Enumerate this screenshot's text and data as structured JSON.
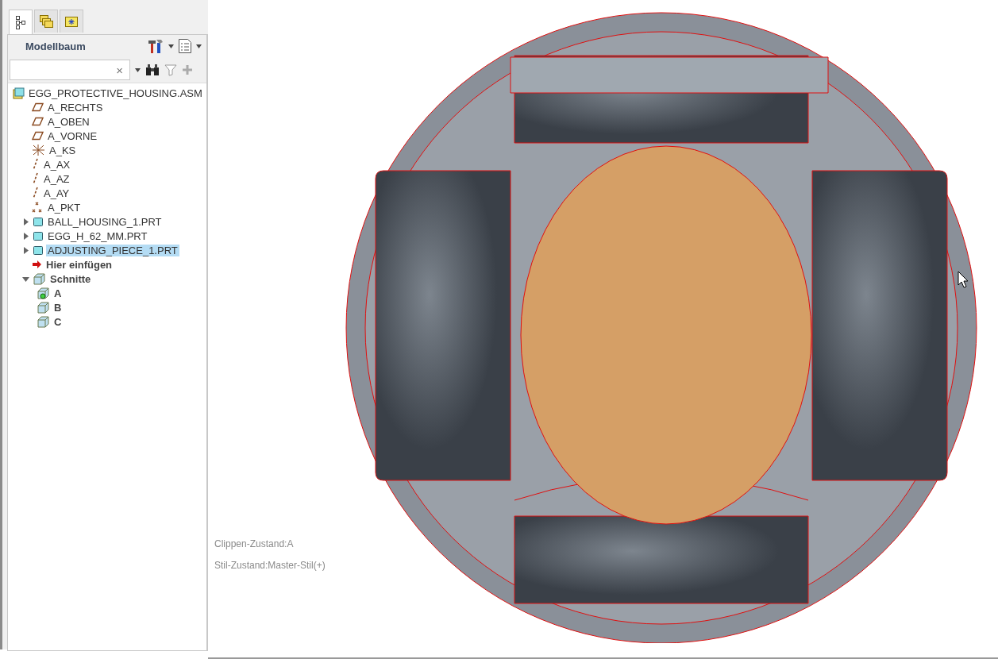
{
  "panel": {
    "tabs": [
      {
        "kind": "tree",
        "selected": true
      },
      {
        "kind": "layers",
        "selected": false
      },
      {
        "kind": "favorites",
        "selected": false
      }
    ],
    "title": "Modellbaum",
    "search": {
      "clear": "×"
    },
    "tree": [
      {
        "label": "EGG_PROTECTIVE_HOUSING.ASM",
        "kind": "assembly",
        "selected": false,
        "children": [
          {
            "label": "A_RECHTS",
            "kind": "plane",
            "selected": false
          },
          {
            "label": "A_OBEN",
            "kind": "plane",
            "selected": false
          },
          {
            "label": "A_VORNE",
            "kind": "plane",
            "selected": false
          },
          {
            "label": "A_KS",
            "kind": "csys",
            "selected": false
          },
          {
            "label": "A_AX",
            "kind": "axis",
            "selected": false
          },
          {
            "label": "A_AZ",
            "kind": "axis",
            "selected": false
          },
          {
            "label": "A_AY",
            "kind": "axis",
            "selected": false
          },
          {
            "label": "A_PKT",
            "kind": "point",
            "selected": false
          },
          {
            "label": "BALL_HOUSING_1.PRT",
            "kind": "part",
            "selected": false,
            "expanded": false
          },
          {
            "label": "EGG_H_62_MM.PRT",
            "kind": "part",
            "selected": false,
            "expanded": false
          },
          {
            "label": "ADJUSTING_PIECE_1.PRT",
            "kind": "part",
            "selected": true,
            "expanded": false
          },
          {
            "label": "Hier einfügen",
            "kind": "insert",
            "selected": false
          },
          {
            "label": "Schnitte",
            "kind": "sections",
            "selected": false,
            "expanded": true,
            "children": [
              {
                "label": "A",
                "kind": "section",
                "selected": false,
                "active": true
              },
              {
                "label": "B",
                "kind": "section",
                "selected": false,
                "active": false
              },
              {
                "label": "C",
                "kind": "section",
                "selected": false,
                "active": false
              }
            ]
          }
        ]
      }
    ]
  },
  "viewport": {
    "status": [
      "Clippen-Zustand:A",
      "Stil-Zustand:Master-Stil(+)"
    ]
  }
}
